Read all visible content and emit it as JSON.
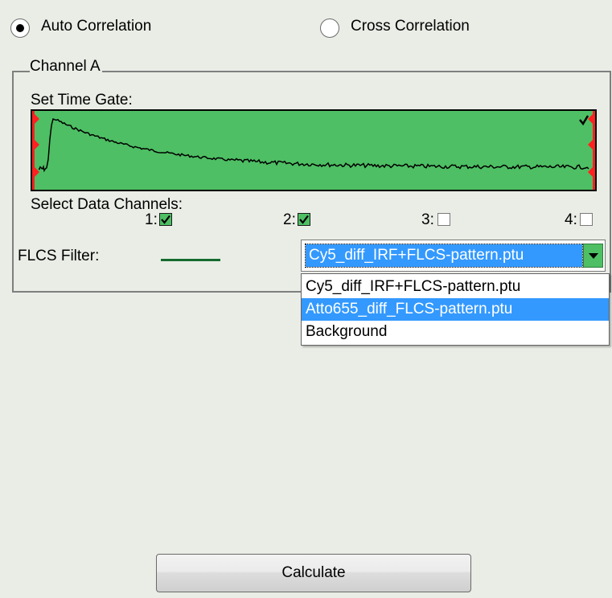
{
  "mode": {
    "auto_label": "Auto Correlation",
    "cross_label": "Cross Correlation",
    "selected": "auto"
  },
  "channel_group": {
    "title": "Channel A",
    "time_gate_label": "Set Time Gate:",
    "data_channels_label": "Select Data Channels:",
    "channels": [
      {
        "label": "1:",
        "checked": true
      },
      {
        "label": "2:",
        "checked": true
      },
      {
        "label": "3:",
        "checked": false
      },
      {
        "label": "4:",
        "checked": false
      }
    ],
    "flcs_filter_label": "FLCS Filter:",
    "flcs_filter_color": "#156b2e"
  },
  "filter_combo": {
    "value": "Cy5_diff_IRF+FLCS-pattern.ptu",
    "options": [
      "Cy5_diff_IRF+FLCS-pattern.ptu",
      "Atto655_diff_FLCS-pattern.ptu",
      "Background"
    ],
    "highlighted_index": 1
  },
  "calculate_label": "Calculate",
  "colors": {
    "background": "#e9ede6",
    "plot_fill": "#4ebf64",
    "gate_marker": "#ff2020",
    "selection": "#3399ff"
  }
}
